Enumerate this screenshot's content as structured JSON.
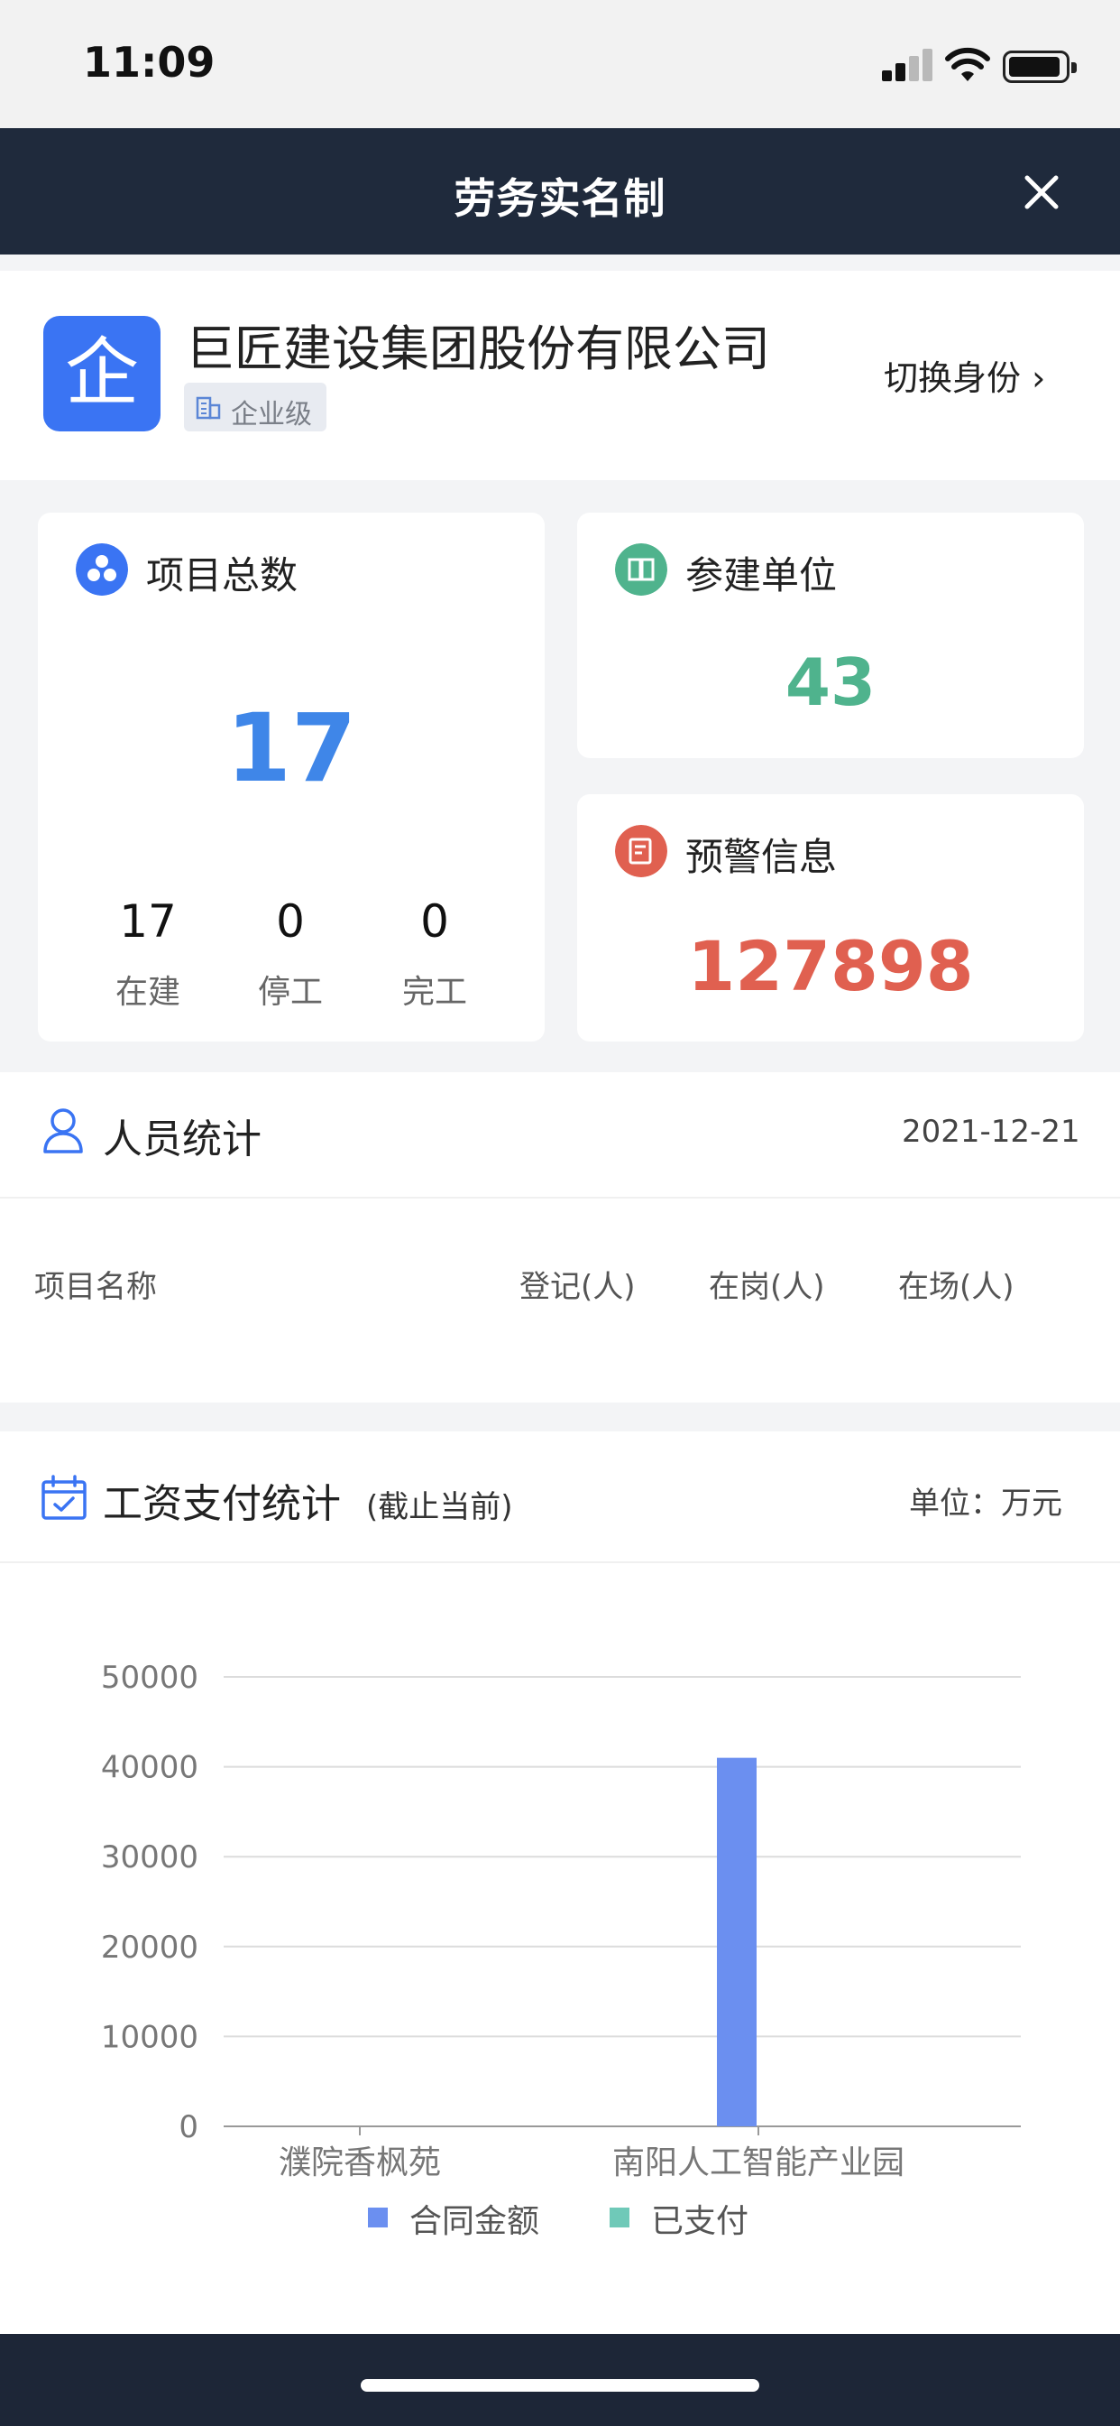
{
  "status_bar": {
    "time": "11:09"
  },
  "nav": {
    "title": "劳务实名制"
  },
  "company": {
    "logo_char": "企",
    "name": "巨匠建设集团股份有限公司",
    "level": "企业级",
    "switch_label": "切换身份 ›"
  },
  "stats": {
    "projects": {
      "label": "项目总数",
      "total": "17",
      "in_progress_value": "17",
      "in_progress_label": "在建",
      "stopped_value": "0",
      "stopped_label": "停工",
      "completed_value": "0",
      "completed_label": "完工"
    },
    "units": {
      "label": "参建单位",
      "value": "43"
    },
    "warnings": {
      "label": "预警信息",
      "value": "127898"
    }
  },
  "personnel": {
    "title": "人员统计",
    "date": "2021-12-21",
    "columns": [
      "项目名称",
      "登记(人)",
      "在岗(人)",
      "在场(人)"
    ]
  },
  "wage": {
    "title": "工资支付统计",
    "subtitle": "(截止当前)",
    "unit": "单位：万元"
  },
  "colors": {
    "nav_bg": "#1f2a3c",
    "primary_blue": "#3a74f3",
    "number_blue": "#3f86e8",
    "number_green": "#4fb38d",
    "number_red": "#e06050",
    "bar_contract": "#6b8ff0",
    "bar_paid": "#6fc9b8"
  },
  "chart_data": {
    "type": "bar",
    "categories": [
      "濮院香枫苑",
      "南阳人工智能产业园"
    ],
    "series": [
      {
        "name": "合同金额",
        "values": [
          0,
          41000
        ]
      },
      {
        "name": "已支付",
        "values": [
          0,
          0
        ]
      }
    ],
    "yticks": [
      "0",
      "10000",
      "20000",
      "30000",
      "40000",
      "50000"
    ],
    "ylim": [
      0,
      50000
    ],
    "grid": true,
    "legend_position": "bottom"
  }
}
